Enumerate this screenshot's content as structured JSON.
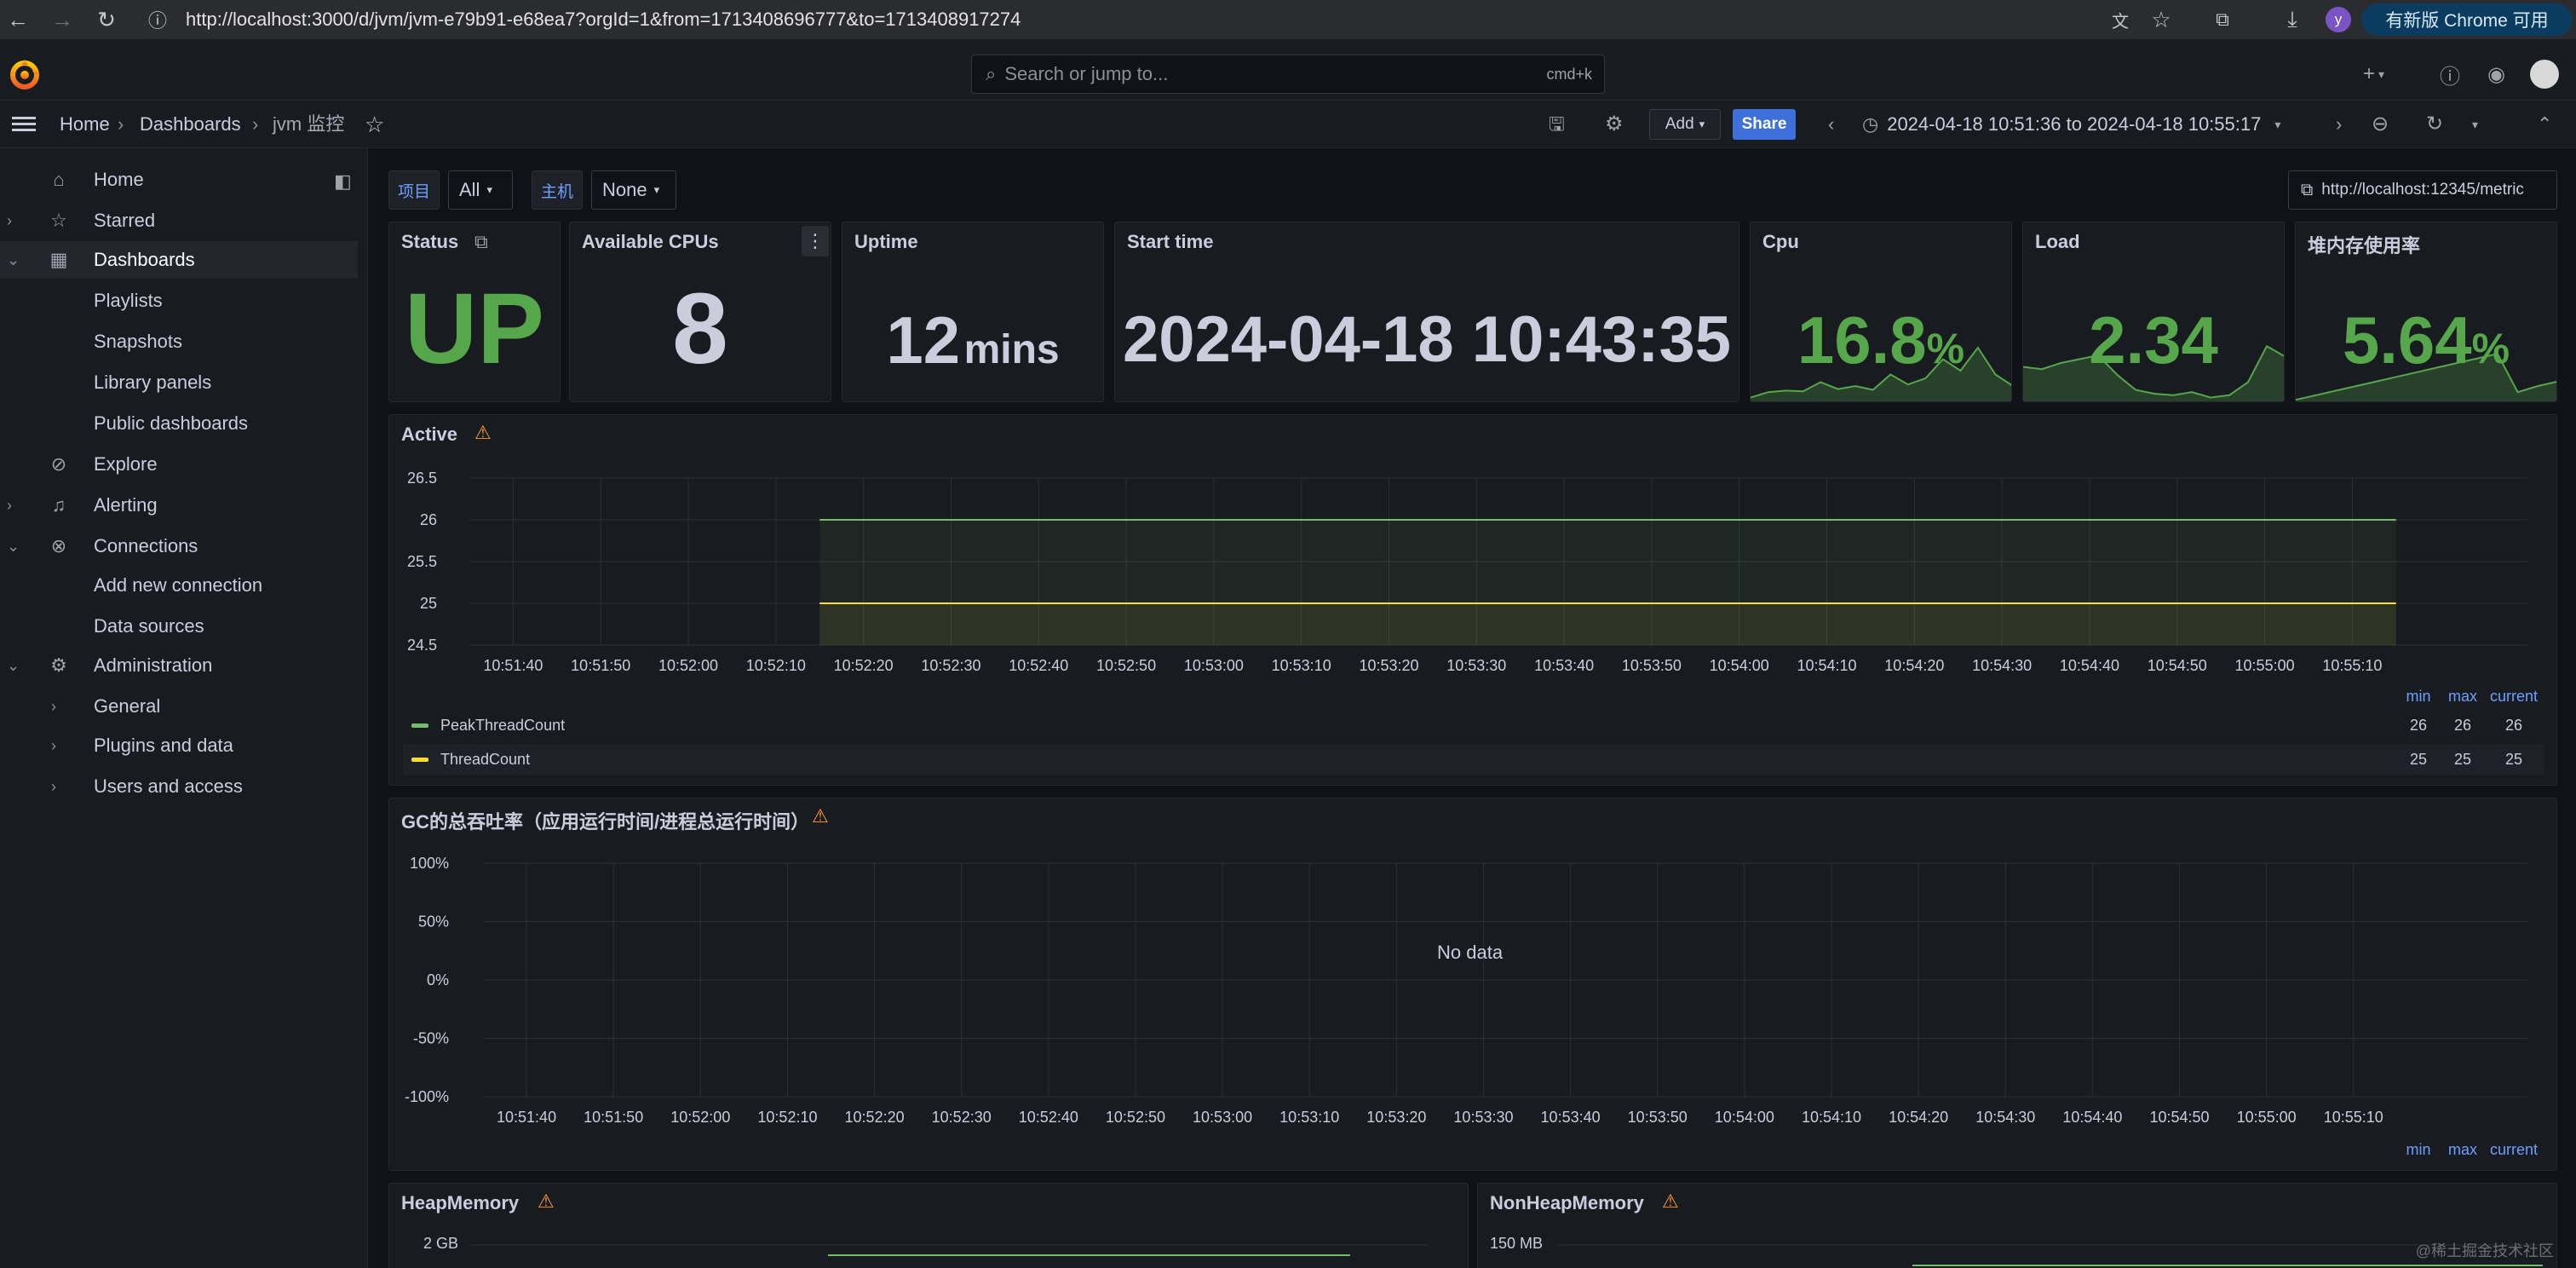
{
  "browser": {
    "url": "http://localhost:3000/d/jvm/jvm-e79b91-e68ea7?orgId=1&from=1713408696777&to=1713408917274",
    "avatar_letter": "y",
    "update_label": "有新版 Chrome 可用"
  },
  "topnav": {
    "search_placeholder": "Search or jump to...",
    "search_shortcut": "cmd+k",
    "new_label": "+"
  },
  "breadcrumb": {
    "home": "Home",
    "dashboards": "Dashboards",
    "current": "jvm 监控"
  },
  "toolbar": {
    "add_label": "Add",
    "share_label": "Share",
    "time_range": "2024-04-18 10:51:36 to 2024-04-18 10:55:17"
  },
  "sidebar": {
    "items": [
      {
        "label": "Home",
        "icon": "home-icon"
      },
      {
        "label": "Starred",
        "icon": "star-icon"
      },
      {
        "label": "Dashboards",
        "icon": "apps-icon"
      },
      {
        "label": "Playlists"
      },
      {
        "label": "Snapshots"
      },
      {
        "label": "Library panels"
      },
      {
        "label": "Public dashboards"
      },
      {
        "label": "Explore",
        "icon": "compass-icon"
      },
      {
        "label": "Alerting",
        "icon": "bell-icon"
      },
      {
        "label": "Connections",
        "icon": "link-icon"
      },
      {
        "label": "Add new connection"
      },
      {
        "label": "Data sources"
      },
      {
        "label": "Administration",
        "icon": "cog-icon"
      },
      {
        "label": "General"
      },
      {
        "label": "Plugins and data"
      },
      {
        "label": "Users and access"
      }
    ]
  },
  "variables": {
    "project_label": "项目",
    "project_value": "All",
    "host_label": "主机",
    "host_value": "None",
    "link_label": "http://localhost:12345/metric"
  },
  "stats": {
    "status": {
      "title": "Status",
      "value": "UP"
    },
    "cpus": {
      "title": "Available CPUs",
      "value": "8"
    },
    "uptime": {
      "title": "Uptime",
      "value": "12",
      "unit": "mins"
    },
    "start": {
      "title": "Start time",
      "value": "2024-04-18 10:43:35"
    },
    "cpu": {
      "title": "Cpu",
      "value": "16.8",
      "unit": "%",
      "spark": [
        0.05,
        0.12,
        0.14,
        0.13,
        0.25,
        0.16,
        0.2,
        0.15,
        0.35,
        0.22,
        0.3,
        0.55,
        0.4,
        0.7,
        0.35,
        0.2
      ]
    },
    "load": {
      "title": "Load",
      "value": "2.34",
      "spark": [
        0.45,
        0.42,
        0.5,
        0.55,
        0.6,
        0.35,
        0.15,
        0.1,
        0.08,
        0.12,
        0.05,
        0.08,
        0.25,
        0.72,
        0.58
      ]
    },
    "heap": {
      "title": "堆内存使用率",
      "value": "5.64",
      "unit": "%",
      "spark": [
        0.02,
        0.08,
        0.14,
        0.2,
        0.26,
        0.32,
        0.38,
        0.44,
        0.5,
        0.56,
        0.62,
        0.12,
        0.2,
        0.26
      ]
    }
  },
  "colors": {
    "green": "#73bf69",
    "yellow": "#fade2a",
    "stat_green": "#56a64b",
    "accent_blue": "#3d71d9",
    "warn": "#ff9830"
  },
  "chart_data": [
    {
      "type": "line",
      "title": "Active",
      "x": [
        "10:51:40",
        "10:51:50",
        "10:52:00",
        "10:52:10",
        "10:52:20",
        "10:52:30",
        "10:52:40",
        "10:52:50",
        "10:53:00",
        "10:53:10",
        "10:53:20",
        "10:53:30",
        "10:53:40",
        "10:53:50",
        "10:54:00",
        "10:54:10",
        "10:54:20",
        "10:54:30",
        "10:54:40",
        "10:54:50",
        "10:55:00",
        "10:55:10"
      ],
      "series": [
        {
          "name": "PeakThreadCount",
          "x_start": "10:52:15",
          "x_end": "10:55:15",
          "value": 26
        },
        {
          "name": "ThreadCount",
          "x_start": "10:52:15",
          "x_end": "10:55:15",
          "value": 25
        }
      ],
      "yticks": [
        "26.5",
        "26",
        "25.5",
        "25",
        "24.5"
      ],
      "ylim": [
        24.5,
        26.5
      ],
      "legend": {
        "headers": [
          "min",
          "max",
          "current"
        ],
        "rows": [
          {
            "name": "PeakThreadCount",
            "min": "26",
            "max": "26",
            "current": "26"
          },
          {
            "name": "ThreadCount",
            "min": "25",
            "max": "25",
            "current": "25"
          }
        ]
      }
    },
    {
      "type": "line",
      "title": "GC的总吞吐率（应用运行时间/进程总运行时间）",
      "x": [
        "10:51:40",
        "10:51:50",
        "10:52:00",
        "10:52:10",
        "10:52:20",
        "10:52:30",
        "10:52:40",
        "10:52:50",
        "10:53:00",
        "10:53:10",
        "10:53:20",
        "10:53:30",
        "10:53:40",
        "10:53:50",
        "10:54:00",
        "10:54:10",
        "10:54:20",
        "10:54:30",
        "10:54:40",
        "10:54:50",
        "10:55:00",
        "10:55:10"
      ],
      "series": [],
      "yticks": [
        "100%",
        "50%",
        "0%",
        "-50%",
        "-100%"
      ],
      "no_data": "No data",
      "legend": {
        "headers": [
          "min",
          "max",
          "current"
        ]
      }
    },
    {
      "type": "line",
      "title": "HeapMemory",
      "yticks": [
        "2 GB"
      ]
    },
    {
      "type": "line",
      "title": "NonHeapMemory",
      "yticks": [
        "150 MB"
      ]
    }
  ],
  "watermark": "@稀土掘金技术社区"
}
